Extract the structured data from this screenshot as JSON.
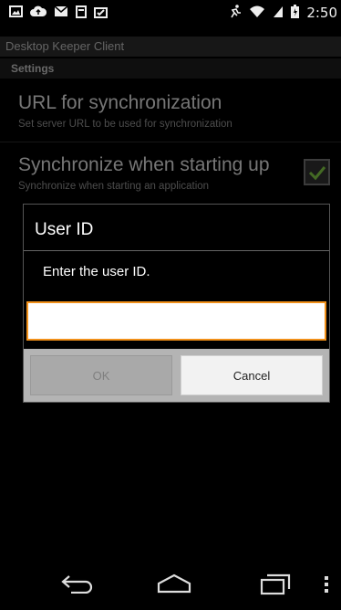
{
  "status_bar": {
    "left_icons": [
      "gallery-icon",
      "cloud-upload-icon",
      "gmail-icon",
      "sd-card-icon",
      "clipboard-check-icon"
    ],
    "right_icons": [
      "running-icon",
      "wifi-icon",
      "signal-icon",
      "battery-icon"
    ],
    "time": "2:50"
  },
  "app": {
    "title": "Desktop Keeper Client",
    "section": "Settings"
  },
  "preferences": [
    {
      "title": "URL for synchronization",
      "summary": "Set server URL to be used for synchronization"
    },
    {
      "title": "Synchronize when starting up",
      "summary": "Synchronize when starting an application",
      "checked": true
    }
  ],
  "dialog": {
    "title": "User ID",
    "message": "Enter the user ID.",
    "input_value": "",
    "ok_label": "OK",
    "cancel_label": "Cancel"
  },
  "nav_bar": {
    "icons": [
      "back-icon",
      "home-icon",
      "recent-apps-icon",
      "overflow-menu-icon"
    ]
  },
  "colors": {
    "accent": "#f19019",
    "checkmark": "#7dc242",
    "dialog_button_bar": "#b4b4b4"
  }
}
